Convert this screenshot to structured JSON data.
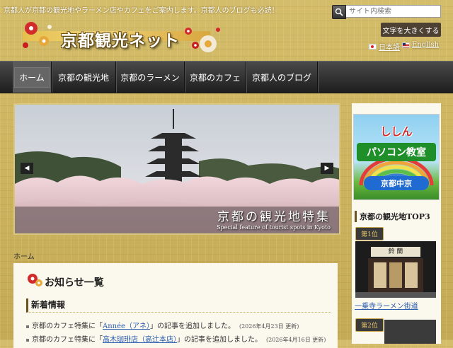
{
  "header": {
    "tagline": "京都人が京都の観光地やラーメン店やカフェをご案内します。京都人のブログも必読！",
    "site_title": "京都観光ネット",
    "search": {
      "placeholder": "サイト内検索"
    },
    "font_size_button": "文字を大きくする",
    "languages": [
      {
        "label": "日本語",
        "flag": "jp-flag-icon"
      },
      {
        "label": "English",
        "flag": "us-flag-icon"
      }
    ]
  },
  "nav": {
    "items": [
      {
        "label": "ホーム",
        "active": true
      },
      {
        "label": "京都の観光地"
      },
      {
        "label": "京都のラーメン"
      },
      {
        "label": "京都のカフェ"
      },
      {
        "label": "京都人のブログ"
      }
    ]
  },
  "slider": {
    "title": "京都の観光地特集",
    "subtitle": "Special feature of tourist spots in Kyoto",
    "prev_icon": "chevron-left-icon",
    "next_icon": "chevron-right-icon"
  },
  "breadcrumb": "ホーム",
  "content": {
    "title": "お知らせ一覧",
    "section_title": "新着情報",
    "news": [
      {
        "prefix": "京都のカフェ特集に「",
        "link": "Année（アネ）",
        "suffix": "」の記事を追加しました。",
        "date": "(2026年4月23日 更新)"
      },
      {
        "prefix": "京都のカフェ特集に「",
        "link": "高木珈琲店（高辻本店）",
        "suffix": "」の記事を追加しました。",
        "date": "(2026年4月16日 更新)"
      }
    ]
  },
  "sidebar": {
    "banner": {
      "line1": "ししん",
      "line2": "パソコン教室",
      "line3": "京都中京"
    },
    "ranking_title": "京都の観光地TOP3",
    "ranks": [
      {
        "badge": "第1位",
        "shop_sign": "鈴 蘭",
        "link": "一乗寺ラーメン街道"
      },
      {
        "badge": "第2位"
      }
    ]
  },
  "colors": {
    "gold": "#c9b25e",
    "nav": "#2a2a2a",
    "link": "#2a5db0",
    "accent_red": "#d12a2a"
  }
}
